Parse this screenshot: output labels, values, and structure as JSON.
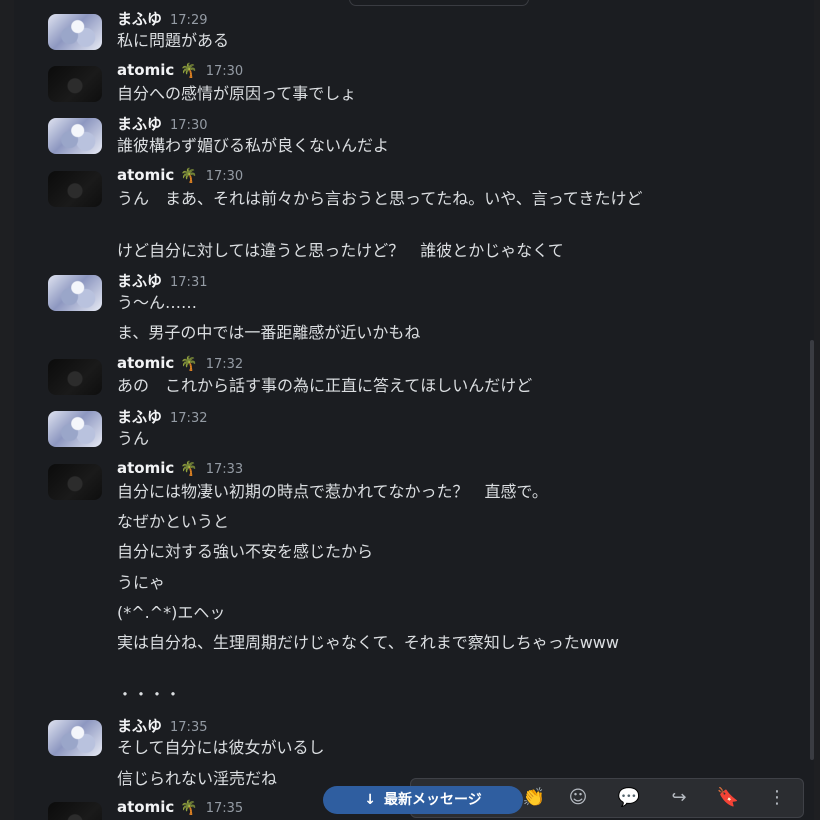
{
  "jump_button": {
    "arrow": "↓",
    "label": "最新メッセージ"
  },
  "toolbar": {
    "icons": [
      "reaction-icon",
      "add-emoji-icon",
      "reply-icon",
      "forward-icon",
      "bookmark-icon",
      "more-icon"
    ],
    "glyphs": [
      "👏",
      "☺",
      "💬",
      "↪",
      "🔖",
      "⋮"
    ]
  },
  "messages": [
    {
      "author": "まふゆ",
      "avatar": "mafuyu",
      "palm": "",
      "time": "17:29",
      "lines": [
        "私に問題がある"
      ]
    },
    {
      "author": "atomic",
      "avatar": "atomic",
      "palm": "🌴",
      "time": "17:30",
      "lines": [
        "自分への感情が原因って事でしょ"
      ]
    },
    {
      "author": "まふゆ",
      "avatar": "mafuyu",
      "palm": "",
      "time": "17:30",
      "lines": [
        "誰彼構わず媚びる私が良くないんだよ"
      ]
    },
    {
      "author": "atomic",
      "avatar": "atomic",
      "palm": "🌴",
      "time": "17:30",
      "lines": [
        "うん　まあ、それは前々から言おうと思ってたね。いや、言ってきたけど",
        "けど自分に対しては違うと思ったけど？　誰彼とかじゃなくて"
      ]
    },
    {
      "author": "まふゆ",
      "avatar": "mafuyu",
      "palm": "",
      "time": "17:31",
      "lines": [
        "う〜ん……",
        "ま、男子の中では一番距離感が近いかもね"
      ]
    },
    {
      "author": "atomic",
      "avatar": "atomic",
      "palm": "🌴",
      "time": "17:32",
      "lines": [
        "あの　これから話す事の為に正直に答えてほしいんだけど"
      ]
    },
    {
      "author": "まふゆ",
      "avatar": "mafuyu",
      "palm": "",
      "time": "17:32",
      "lines": [
        "うん"
      ]
    },
    {
      "author": "atomic",
      "avatar": "atomic",
      "palm": "🌴",
      "time": "17:33",
      "lines": [
        "自分には物凄い初期の時点で惹かれてなかった？　直感で。",
        "なぜかというと",
        "自分に対する強い不安を感じたから",
        "うにゃ",
        "(*^.^*)エヘッ",
        "実は自分ね、生理周期だけじゃなくて、それまで察知しちゃったwww",
        "・・・・"
      ]
    },
    {
      "author": "まふゆ",
      "avatar": "mafuyu",
      "palm": "",
      "time": "17:35",
      "lines": [
        "そして自分には彼女がいるし",
        "信じられない淫売だね"
      ]
    },
    {
      "author": "atomic",
      "avatar": "atomic",
      "palm": "🌴",
      "time": "17:35",
      "lines": []
    }
  ]
}
